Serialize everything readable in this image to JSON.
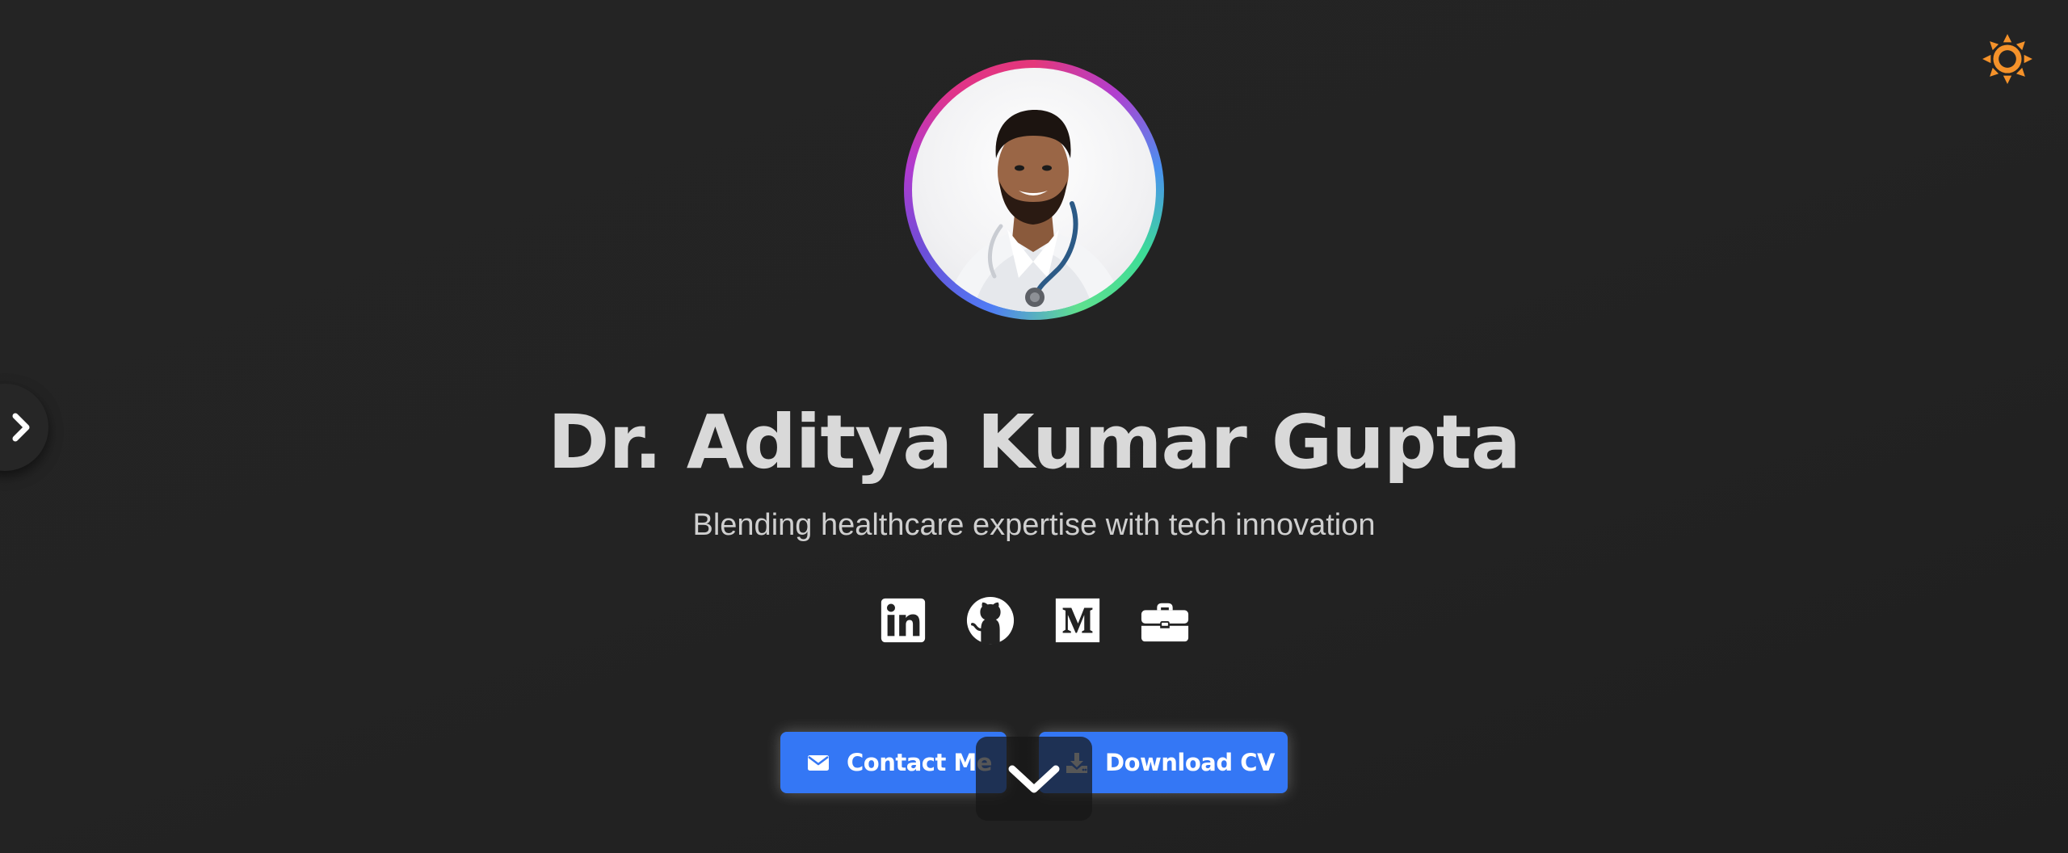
{
  "profile": {
    "name": "Dr. Aditya Kumar Gupta",
    "tagline": "Blending healthcare expertise with tech innovation"
  },
  "socials": [
    {
      "icon": "linkedin-icon"
    },
    {
      "icon": "github-icon"
    },
    {
      "icon": "medium-icon"
    },
    {
      "icon": "briefcase-icon"
    }
  ],
  "buttons": {
    "contact_label": "Contact Me",
    "cv_label": "Download CV"
  },
  "icons": {
    "theme_toggle": "sun-icon",
    "sidebar_toggle": "chevron-right-icon",
    "scroll_down": "chevron-down-icon"
  },
  "colors": {
    "background": "#232323",
    "accent": "#3477f5",
    "sun": "#f5922a",
    "name_text": "#d9d9d9",
    "tagline_text": "#cfcfcf"
  }
}
